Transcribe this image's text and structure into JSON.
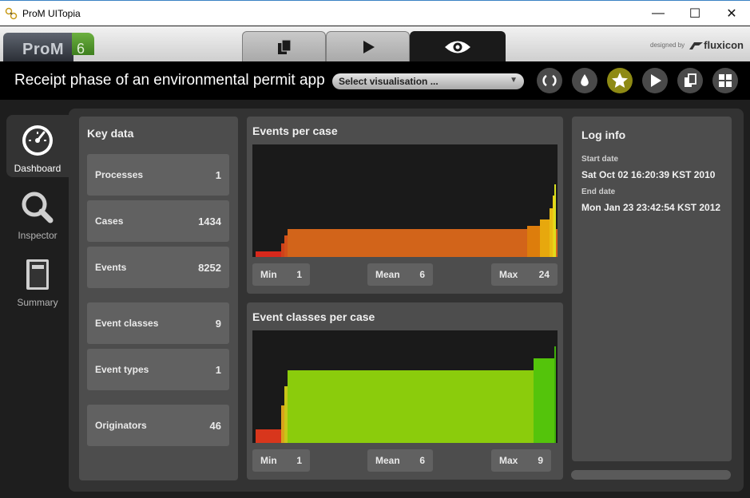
{
  "window": {
    "title": "ProM UITopia",
    "controls": {
      "minimize": "—",
      "maximize": "☐",
      "close": "✕"
    }
  },
  "header": {
    "logo_text": "ProM",
    "logo_version": "6",
    "brand_prefix": "designed by",
    "brand_name": "fluxicon",
    "mode_tabs": [
      {
        "icon": "copy-icon",
        "active": false
      },
      {
        "icon": "play-icon",
        "active": false
      },
      {
        "icon": "eye-icon",
        "active": true
      }
    ]
  },
  "strip": {
    "log_title": "Receipt phase of an environmental permit app",
    "visualisation_placeholder": "Select visualisation ...",
    "tools": [
      {
        "icon": "refresh-icon",
        "active": false
      },
      {
        "icon": "drop-icon",
        "active": false
      },
      {
        "icon": "star-icon",
        "active": true
      },
      {
        "icon": "play-icon",
        "active": false
      },
      {
        "icon": "copy-icon",
        "active": false
      },
      {
        "icon": "grid-icon",
        "active": false
      }
    ]
  },
  "sidebar": {
    "items": [
      {
        "label": "Dashboard",
        "icon": "dashboard-gauge-icon",
        "active": true
      },
      {
        "label": "Inspector",
        "icon": "magnifier-icon",
        "active": false
      },
      {
        "label": "Summary",
        "icon": "book-icon",
        "active": false
      }
    ]
  },
  "key_data": {
    "title": "Key data",
    "rows": [
      {
        "label": "Processes",
        "value": "1"
      },
      {
        "label": "Cases",
        "value": "1434"
      },
      {
        "label": "Events",
        "value": "8252"
      },
      {
        "label": "Event classes",
        "value": "9"
      },
      {
        "label": "Event types",
        "value": "1"
      },
      {
        "label": "Originators",
        "value": "46"
      }
    ]
  },
  "events_per_case": {
    "title": "Events per case",
    "min_label": "Min",
    "min": "1",
    "mean_label": "Mean",
    "mean": "6",
    "max_label": "Max",
    "max": "24"
  },
  "event_classes_per_case": {
    "title": "Event classes per case",
    "min_label": "Min",
    "min": "1",
    "mean_label": "Mean",
    "mean": "6",
    "max_label": "Max",
    "max": "9"
  },
  "log_info": {
    "title": "Log info",
    "start_label": "Start date",
    "start_value": "Sat Oct 02 16:20:39 KST 2010",
    "end_label": "End date",
    "end_value": "Mon Jan 23 23:42:54 KST 2012"
  },
  "colors": {
    "events_chart": [
      "#d8281c",
      "#d0421a",
      "#d2641a",
      "#dd7d0c",
      "#e7a80d",
      "#ecd217"
    ],
    "classes_chart": [
      "#d8361c",
      "#d9a31b",
      "#c8c617",
      "#8bcc0c",
      "#54c40b"
    ],
    "active_tool": "#8e8a14"
  }
}
